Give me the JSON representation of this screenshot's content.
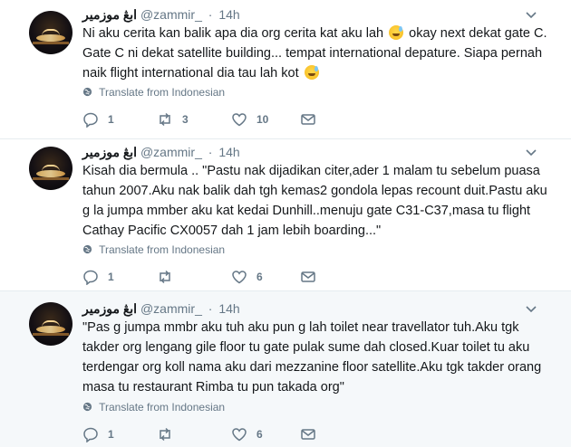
{
  "tweets": [
    {
      "author_name": "ابڠ موزمير",
      "handle": "@zammir_",
      "separator": "·",
      "time": "14h",
      "text_before_emoji1": "Ni aku cerita kan balik apa dia org cerita kat aku lah",
      "text_mid": "okay next dekat gate C. Gate C ni dekat satellite building... tempat international depature. Siapa pernah naik flight international dia tau lah kot",
      "emoji_name": "grinning-face-with-sweat",
      "translate_label": "Translate from Indonesian",
      "reply_count": "1",
      "retweet_count": "3",
      "like_count": "10"
    },
    {
      "author_name": "ابڠ موزمير",
      "handle": "@zammir_",
      "separator": "·",
      "time": "14h",
      "text": "Kisah dia bermula .. \"Pastu nak dijadikan citer,ader 1 malam tu sebelum puasa tahun 2007.Aku nak balik dah tgh kemas2 gondola lepas recount duit.Pastu aku g la jumpa mmber aku kat kedai Dunhill..menuju gate C31-C37,masa tu flight Cathay Pacific CX0057 dah 1 jam lebih boarding...\"",
      "translate_label": "Translate from Indonesian",
      "reply_count": "1",
      "retweet_count": "",
      "like_count": "6"
    },
    {
      "author_name": "ابڠ موزمير",
      "handle": "@zammir_",
      "separator": "·",
      "time": "14h",
      "text": "\"Pas g jumpa mmbr aku tuh aku pun g lah toilet near travellator tuh.Aku tgk takder org lengang gile floor tu gate pulak sume dah closed.Kuar toilet tu aku terdengar org koll nama aku dari mezzanine floor satellite.Aku tgk takder orang masa tu restaurant Rimba tu pun takada org\"",
      "translate_label": "Translate from Indonesian",
      "reply_count": "1",
      "retweet_count": "",
      "like_count": "6"
    }
  ],
  "icons": {
    "reply": "reply-icon",
    "retweet": "retweet-icon",
    "like": "heart-icon",
    "dm": "direct-message-icon",
    "caret": "chevron-down-icon",
    "globe": "globe-icon"
  },
  "colors": {
    "text": "#14171a",
    "muted": "#657786",
    "divider": "#e6ecf0",
    "highlight_bg": "#f5f8fa"
  }
}
